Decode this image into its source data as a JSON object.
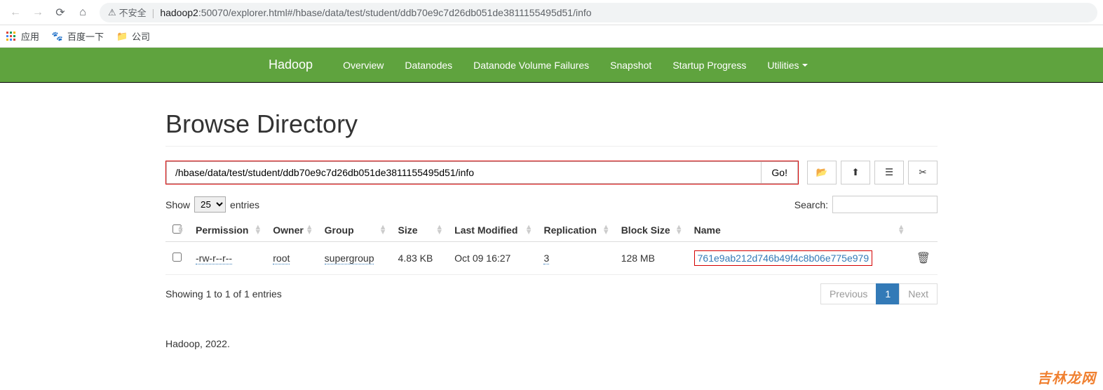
{
  "browser": {
    "insecure_label": "不安全",
    "url_host": "hadoop2",
    "url_path": ":50070/explorer.html#/hbase/data/test/student/ddb70e9c7d26db051de3811155495d51/info"
  },
  "bookmarks": {
    "apps": "应用",
    "baidu": "百度一下",
    "company": "公司"
  },
  "navbar": {
    "brand": "Hadoop",
    "links": [
      "Overview",
      "Datanodes",
      "Datanode Volume Failures",
      "Snapshot",
      "Startup Progress",
      "Utilities"
    ]
  },
  "page": {
    "title": "Browse Directory",
    "path_value": "/hbase/data/test/student/ddb70e9c7d26db051de3811155495d51/info",
    "go_label": "Go!"
  },
  "controls": {
    "show_label": "Show",
    "entries_label": "entries",
    "page_size": "25",
    "search_label": "Search:"
  },
  "table": {
    "headers": [
      "Permission",
      "Owner",
      "Group",
      "Size",
      "Last Modified",
      "Replication",
      "Block Size",
      "Name"
    ],
    "rows": [
      {
        "permission": "-rw-r--r--",
        "owner": "root",
        "group": "supergroup",
        "size": "4.83 KB",
        "modified": "Oct 09 16:27",
        "replication": "3",
        "block_size": "128 MB",
        "name": "761e9ab212d746b49f4c8b06e775e979"
      }
    ],
    "showing": "Showing 1 to 1 of 1 entries",
    "prev": "Previous",
    "page": "1",
    "next": "Next"
  },
  "footer": "Hadoop, 2022.",
  "watermark": "吉林龙网"
}
